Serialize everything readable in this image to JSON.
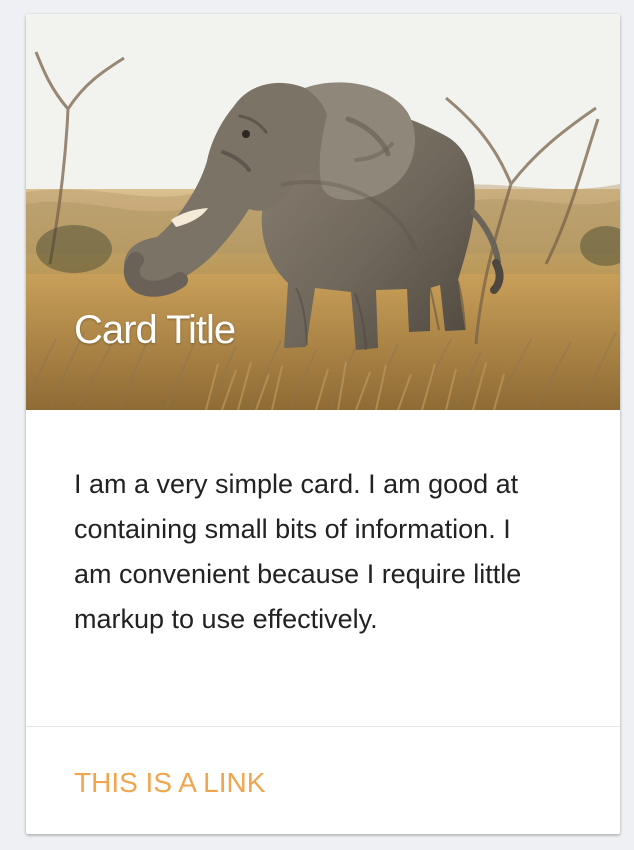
{
  "card": {
    "title": "Card Title",
    "body": "I am a very simple card. I am good at containing small bits of information. I am convenient because I require little markup to use effectively.",
    "link_label": "THIS IS A LINK",
    "link_color": "#f0a64e",
    "image": {
      "subject_icon": "elephant-photo-icon"
    }
  }
}
